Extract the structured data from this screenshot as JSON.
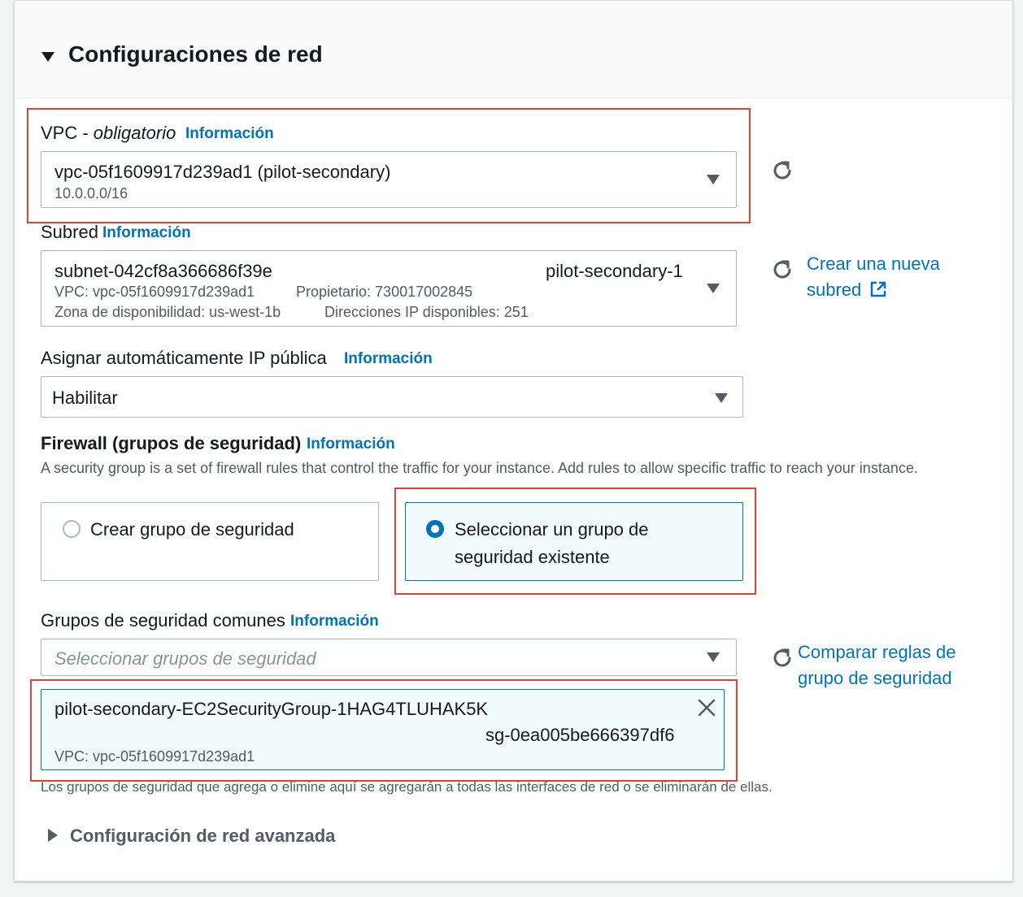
{
  "section": {
    "title": "Configuraciones de red"
  },
  "vpc": {
    "label": "VPC - ",
    "label_italic": "obligatorio",
    "info": "Información",
    "value": "vpc-05f1609917d239ad1 (pilot-secondary)",
    "cidr": "10.0.0.0/16"
  },
  "subnet": {
    "label": "Subred",
    "info": "Información",
    "id": "subnet-042cf8a366686f39e",
    "name": "pilot-secondary-1",
    "vpc": "VPC: vpc-05f1609917d239ad1",
    "owner": "Propietario: 730017002845",
    "az": "Zona de disponibilidad: us-west-1b",
    "ips": "Direcciones IP disponibles: 251",
    "create_link_line1": "Crear una nueva",
    "create_link_line2": "subred"
  },
  "public_ip": {
    "label": "Asignar automáticamente IP pública",
    "info": "Información",
    "value": "Habilitar"
  },
  "firewall": {
    "label": "Firewall (grupos de seguridad)",
    "info": "Información",
    "description": "A security group is a set of firewall rules that control the traffic for your instance. Add rules to allow specific traffic to reach your instance.",
    "option_create": "Crear grupo de seguridad",
    "option_select_line1": "Seleccionar un grupo de",
    "option_select_line2": "seguridad existente"
  },
  "common_groups": {
    "label": "Grupos de seguridad comunes",
    "info": "Información",
    "placeholder": "Seleccionar grupos de seguridad",
    "compare_link_line1": "Comparar reglas de",
    "compare_link_line2": "grupo de seguridad",
    "token_name": "pilot-secondary-EC2SecurityGroup-1HAG4TLUHAK5K",
    "token_id": "sg-0ea005be666397df6",
    "token_vpc": "VPC: vpc-05f1609917d239ad1",
    "hint": "Los grupos de seguridad que agrega o elimine aquí se agregarán a todas las interfaces de red o se eliminarán de ellas."
  },
  "advanced": {
    "label": "Configuración de red avanzada"
  },
  "icons": {
    "refresh": "refresh-icon",
    "external": "external-link-icon",
    "close": "close-icon",
    "caret_down": "caret-down-icon",
    "caret_right": "caret-right-icon"
  },
  "colors": {
    "link": "#0073bb",
    "highlight": "#e0432f",
    "selected_bg": "#f1faff"
  }
}
